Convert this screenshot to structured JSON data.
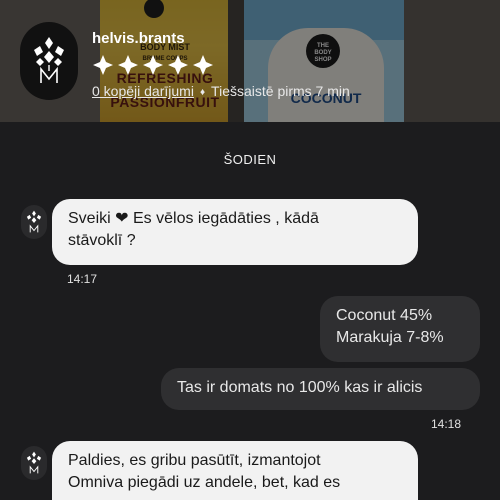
{
  "header": {
    "username": "helvis.brants",
    "rating_stars": 5,
    "deals_link": "0 kopēji darījumi",
    "status_separator": "♦",
    "online_status": "Tiešsaistē pirms 7 min",
    "background_products": {
      "left_bottle": [
        "BODY MIST",
        "BRUME CORPS",
        "REFRESHING",
        "PASSIONFRUIT"
      ],
      "right_bottle_logo": [
        "THE",
        "BODY",
        "SHOP"
      ],
      "right_bottle_name": "COCONUT"
    }
  },
  "chat": {
    "day_label": "ŠODIEN",
    "messages": [
      {
        "direction": "incoming",
        "line1_before_heart": "Sveiki",
        "heart": "❤",
        "line1_after_heart": "Es vēlos iegādāties , kādā",
        "line2": "stāvoklī ?",
        "time": "14:17"
      },
      {
        "direction": "outgoing",
        "line1": "Coconut 45%",
        "line2": "Marakuja 7-8%"
      },
      {
        "direction": "outgoing",
        "line1": "Tas ir domats no 100% kas ir alicis",
        "time": "14:18"
      },
      {
        "direction": "incoming",
        "line1": "Paldies, es gribu pasūtīt, izmantojot",
        "line2": "Omniva piegādi uz andele, bet, kad es"
      }
    ]
  },
  "colors": {
    "background": "#1c1c1e",
    "incoming_bubble": "#f2f2f2",
    "outgoing_bubble": "#2f2f31",
    "text_light": "#ffffff"
  },
  "icons": {
    "avatar_logo": "diamond-logo-icon",
    "rating_star": "diamond-star-icon"
  }
}
